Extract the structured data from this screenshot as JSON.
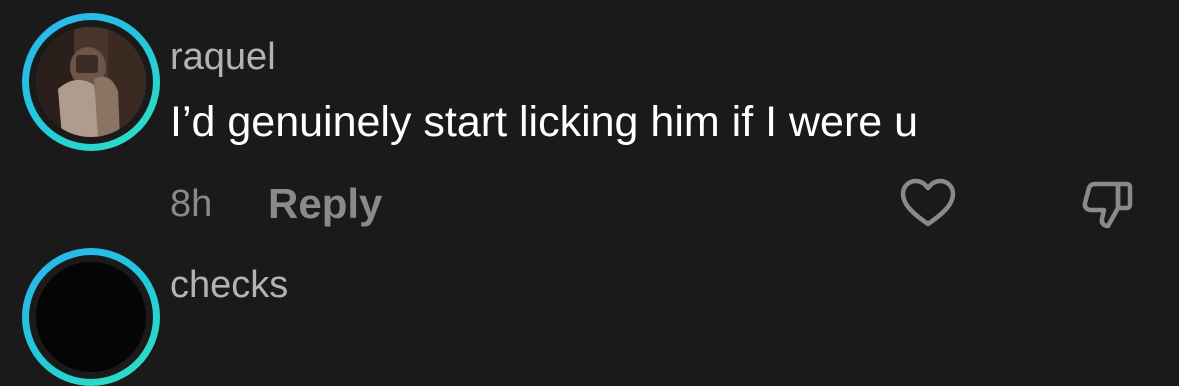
{
  "comments": [
    {
      "username": "raquel",
      "text": "I’d genuinely start licking him if I were u",
      "time": "8h",
      "reply_label": "Reply",
      "avatar": "profile-photo",
      "like_icon": "heart-outline-icon",
      "dislike_icon": "thumbs-down-outline-icon"
    },
    {
      "username": "checks",
      "avatar": "profile-photo-dark"
    }
  ],
  "colors": {
    "background": "#1a1a1a",
    "username": "#b3b3b3",
    "text": "#ffffff",
    "meta": "#8a8a8a",
    "ring_start": "#2bb3f0",
    "ring_end": "#2ee3c0"
  }
}
